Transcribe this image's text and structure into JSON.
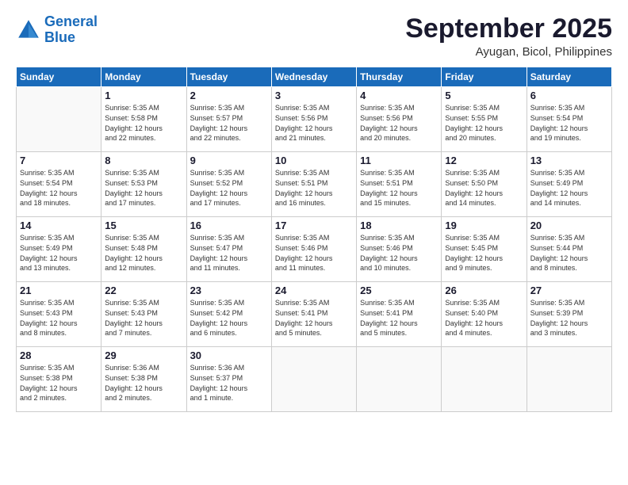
{
  "header": {
    "logo_line1": "General",
    "logo_line2": "Blue",
    "month": "September 2025",
    "location": "Ayugan, Bicol, Philippines"
  },
  "columns": [
    "Sunday",
    "Monday",
    "Tuesday",
    "Wednesday",
    "Thursday",
    "Friday",
    "Saturday"
  ],
  "weeks": [
    [
      {
        "day": "",
        "info": ""
      },
      {
        "day": "1",
        "info": "Sunrise: 5:35 AM\nSunset: 5:58 PM\nDaylight: 12 hours\nand 22 minutes."
      },
      {
        "day": "2",
        "info": "Sunrise: 5:35 AM\nSunset: 5:57 PM\nDaylight: 12 hours\nand 22 minutes."
      },
      {
        "day": "3",
        "info": "Sunrise: 5:35 AM\nSunset: 5:56 PM\nDaylight: 12 hours\nand 21 minutes."
      },
      {
        "day": "4",
        "info": "Sunrise: 5:35 AM\nSunset: 5:56 PM\nDaylight: 12 hours\nand 20 minutes."
      },
      {
        "day": "5",
        "info": "Sunrise: 5:35 AM\nSunset: 5:55 PM\nDaylight: 12 hours\nand 20 minutes."
      },
      {
        "day": "6",
        "info": "Sunrise: 5:35 AM\nSunset: 5:54 PM\nDaylight: 12 hours\nand 19 minutes."
      }
    ],
    [
      {
        "day": "7",
        "info": "Sunrise: 5:35 AM\nSunset: 5:54 PM\nDaylight: 12 hours\nand 18 minutes."
      },
      {
        "day": "8",
        "info": "Sunrise: 5:35 AM\nSunset: 5:53 PM\nDaylight: 12 hours\nand 17 minutes."
      },
      {
        "day": "9",
        "info": "Sunrise: 5:35 AM\nSunset: 5:52 PM\nDaylight: 12 hours\nand 17 minutes."
      },
      {
        "day": "10",
        "info": "Sunrise: 5:35 AM\nSunset: 5:51 PM\nDaylight: 12 hours\nand 16 minutes."
      },
      {
        "day": "11",
        "info": "Sunrise: 5:35 AM\nSunset: 5:51 PM\nDaylight: 12 hours\nand 15 minutes."
      },
      {
        "day": "12",
        "info": "Sunrise: 5:35 AM\nSunset: 5:50 PM\nDaylight: 12 hours\nand 14 minutes."
      },
      {
        "day": "13",
        "info": "Sunrise: 5:35 AM\nSunset: 5:49 PM\nDaylight: 12 hours\nand 14 minutes."
      }
    ],
    [
      {
        "day": "14",
        "info": "Sunrise: 5:35 AM\nSunset: 5:49 PM\nDaylight: 12 hours\nand 13 minutes."
      },
      {
        "day": "15",
        "info": "Sunrise: 5:35 AM\nSunset: 5:48 PM\nDaylight: 12 hours\nand 12 minutes."
      },
      {
        "day": "16",
        "info": "Sunrise: 5:35 AM\nSunset: 5:47 PM\nDaylight: 12 hours\nand 11 minutes."
      },
      {
        "day": "17",
        "info": "Sunrise: 5:35 AM\nSunset: 5:46 PM\nDaylight: 12 hours\nand 11 minutes."
      },
      {
        "day": "18",
        "info": "Sunrise: 5:35 AM\nSunset: 5:46 PM\nDaylight: 12 hours\nand 10 minutes."
      },
      {
        "day": "19",
        "info": "Sunrise: 5:35 AM\nSunset: 5:45 PM\nDaylight: 12 hours\nand 9 minutes."
      },
      {
        "day": "20",
        "info": "Sunrise: 5:35 AM\nSunset: 5:44 PM\nDaylight: 12 hours\nand 8 minutes."
      }
    ],
    [
      {
        "day": "21",
        "info": "Sunrise: 5:35 AM\nSunset: 5:43 PM\nDaylight: 12 hours\nand 8 minutes."
      },
      {
        "day": "22",
        "info": "Sunrise: 5:35 AM\nSunset: 5:43 PM\nDaylight: 12 hours\nand 7 minutes."
      },
      {
        "day": "23",
        "info": "Sunrise: 5:35 AM\nSunset: 5:42 PM\nDaylight: 12 hours\nand 6 minutes."
      },
      {
        "day": "24",
        "info": "Sunrise: 5:35 AM\nSunset: 5:41 PM\nDaylight: 12 hours\nand 5 minutes."
      },
      {
        "day": "25",
        "info": "Sunrise: 5:35 AM\nSunset: 5:41 PM\nDaylight: 12 hours\nand 5 minutes."
      },
      {
        "day": "26",
        "info": "Sunrise: 5:35 AM\nSunset: 5:40 PM\nDaylight: 12 hours\nand 4 minutes."
      },
      {
        "day": "27",
        "info": "Sunrise: 5:35 AM\nSunset: 5:39 PM\nDaylight: 12 hours\nand 3 minutes."
      }
    ],
    [
      {
        "day": "28",
        "info": "Sunrise: 5:35 AM\nSunset: 5:38 PM\nDaylight: 12 hours\nand 2 minutes."
      },
      {
        "day": "29",
        "info": "Sunrise: 5:36 AM\nSunset: 5:38 PM\nDaylight: 12 hours\nand 2 minutes."
      },
      {
        "day": "30",
        "info": "Sunrise: 5:36 AM\nSunset: 5:37 PM\nDaylight: 12 hours\nand 1 minute."
      },
      {
        "day": "",
        "info": ""
      },
      {
        "day": "",
        "info": ""
      },
      {
        "day": "",
        "info": ""
      },
      {
        "day": "",
        "info": ""
      }
    ]
  ]
}
